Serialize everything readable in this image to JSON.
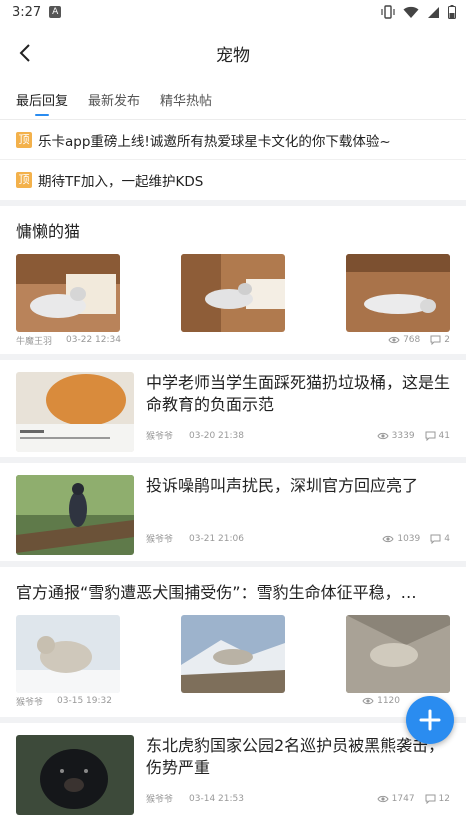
{
  "status_bar": {
    "time": "3:27"
  },
  "header": {
    "title": "宠物"
  },
  "tabs": [
    {
      "label": "最后回复",
      "active": true
    },
    {
      "label": "最新发布",
      "active": false
    },
    {
      "label": "精华热帖",
      "active": false
    }
  ],
  "pinned": [
    {
      "badge": "顶",
      "text": "乐卡app重磅上线!诚邀所有热爱球星卡文化的你下载体验~"
    },
    {
      "badge": "顶",
      "text": "期待TF加入，一起维护KDS"
    }
  ],
  "posts": [
    {
      "title": "慵懒的猫",
      "author": "牛魔王羽",
      "time": "03-22 12:34",
      "views": "768",
      "comments": "2"
    },
    {
      "title": "中学老师当学生面踩死猫扔垃圾桶，这是生命教育的负面示范",
      "author": "猴爷爷",
      "time": "03-20 21:38",
      "views": "3339",
      "comments": "41"
    },
    {
      "title": "投诉噪鹃叫声扰民，深圳官方回应亮了",
      "author": "猴爷爷",
      "time": "03-21 21:06",
      "views": "1039",
      "comments": "4"
    },
    {
      "title": "官方通报“雪豹遭恶犬围捕受伤”：雪豹生命体征平稳，…",
      "author": "猴爷爷",
      "time": "03-15 19:32",
      "views": "1120",
      "comments": ""
    },
    {
      "title": "东北虎豹国家公园2名巡护员被黑熊袭击，伤势严重",
      "author": "猴爷爷",
      "time": "03-14 21:53",
      "views": "1747",
      "comments": "12"
    }
  ],
  "colors": {
    "accent": "#2a8cf0",
    "pin_badge": "#f3b14b",
    "separator": "#f1f2f4"
  },
  "icons": {
    "back": "chevron-left-icon",
    "views": "eye-icon",
    "comments": "comment-icon",
    "fab": "plus-icon"
  }
}
